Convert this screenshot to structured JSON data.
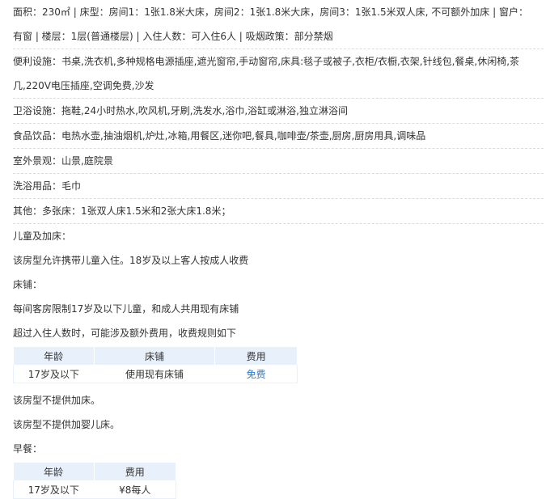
{
  "room_info": {
    "line1": "面积：230㎡ | 床型：房间1：1张1.8米大床，房间2：1张1.8米大床，房间3：1张1.5米双人床, 不可额外加床 | 窗户：",
    "line2": "有窗 | 楼层：1层(普通楼层) | 入住人数：可入住6人 | 吸烟政策：部分禁烟"
  },
  "facilities": {
    "convenience": "便利设施：书桌,洗衣机,多种规格电源插座,遮光窗帘,手动窗帘,床具:毯子或被子,衣柜/衣橱,衣架,针线包,餐桌,休闲椅,茶几,220V电压插座,空调免费,沙发",
    "bathroom": "卫浴设施：拖鞋,24小时热水,吹风机,牙刷,洗发水,浴巾,浴缸或淋浴,独立淋浴间",
    "food": "食品饮品：电热水壶,抽油烟机,炉灶,冰箱,用餐区,迷你吧,餐具,咖啡壶/茶壶,厨房,厨房用具,调味品",
    "view": "室外景观：山景,庭院景",
    "toiletries": "洗浴用品：毛巾",
    "other": "其他：多张床：1张双人床1.5米和2张大床1.8米；"
  },
  "children": {
    "heading": "儿童及加床：",
    "policy": "该房型允许携带儿童入住。18岁及以上客人按成人收费",
    "bed_heading": "床铺：",
    "bed_limit": "每间客房限制17岁及以下儿童，和成人共用现有床铺",
    "over_limit": "超过入住人数时，可能涉及额外费用，收费规则如下",
    "bed_table": {
      "headers": [
        "年龄",
        "床铺",
        "费用"
      ],
      "rows": [
        [
          "17岁及以下",
          "使用现有床铺",
          "免费"
        ]
      ]
    },
    "no_extra_bed": "该房型不提供加床。",
    "no_crib": "该房型不提供加婴儿床。"
  },
  "breakfast": {
    "heading": "早餐：",
    "table": {
      "headers": [
        "年龄",
        "费用"
      ],
      "rows": [
        [
          "17岁及以下",
          "¥8每人"
        ]
      ]
    }
  }
}
